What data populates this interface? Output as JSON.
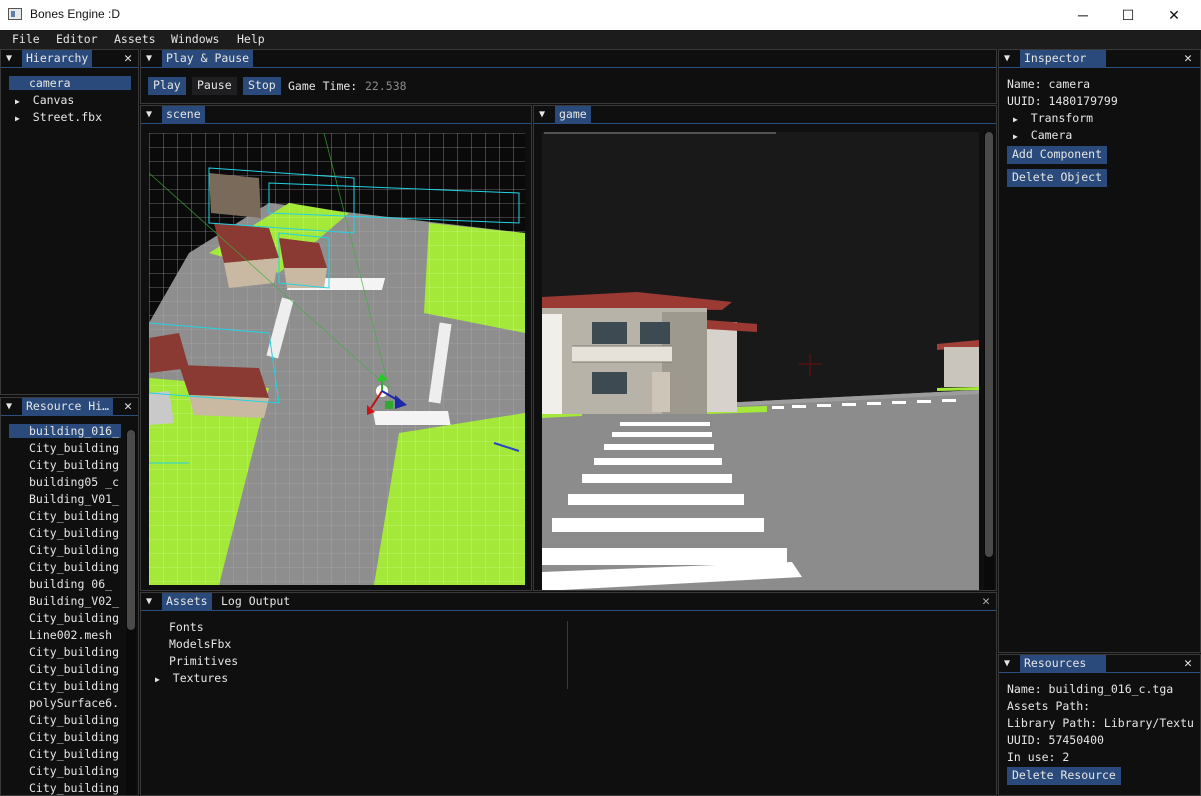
{
  "window": {
    "title": "Bones Engine :D",
    "minimize": "─",
    "maximize": "☐",
    "close": "✕"
  },
  "menu": [
    "File",
    "Editor",
    "Assets",
    "Windows",
    "Help"
  ],
  "hierarchy": {
    "title": "Hierarchy",
    "items": [
      {
        "label": "camera",
        "selected": true,
        "expandable": false
      },
      {
        "label": "Canvas",
        "selected": false,
        "expandable": true
      },
      {
        "label": "Street.fbx",
        "selected": false,
        "expandable": true
      }
    ]
  },
  "resource_hierarchy": {
    "title": "Resource Hi…",
    "items": [
      "building_016_",
      "City_building",
      "City_building",
      "building05 _c",
      "Building_V01_",
      "City_building",
      "City_building",
      "City_building",
      "City_building",
      "building 06_",
      "Building_V02_",
      "City_building",
      "Line002.mesh",
      "City_building",
      "City_building",
      "City_building",
      "polySurface6.",
      "City_building",
      "City_building",
      "City_building",
      "City_building",
      "City_building"
    ]
  },
  "play_pause": {
    "title": "Play & Pause",
    "play": "Play",
    "pause": "Pause",
    "stop": "Stop",
    "game_time_label": "Game Time:",
    "game_time_value": "22.538"
  },
  "scene": {
    "title": "scene"
  },
  "game": {
    "title": "game"
  },
  "assets": {
    "tabs": [
      "Assets",
      "Log Output"
    ],
    "folders": [
      {
        "label": "Fonts",
        "expandable": false
      },
      {
        "label": "ModelsFbx",
        "expandable": false
      },
      {
        "label": "Primitives",
        "expandable": false
      },
      {
        "label": "Textures",
        "expandable": true
      }
    ]
  },
  "inspector": {
    "title": "Inspector",
    "name": "Name: camera",
    "uuid": "UUID: 1480179799",
    "components": [
      "Transform",
      "Camera"
    ],
    "add_component": "Add Component",
    "delete_object": "Delete Object"
  },
  "resources": {
    "title": "Resources",
    "name": "Name: building_016_c.tga",
    "assets_path": "Assets Path:",
    "library_path": "Library Path: Library/Textu",
    "uuid": "UUID: 57450400",
    "in_use": "In use: 2",
    "delete_resource": "Delete Resource"
  },
  "icons": {
    "collapse": "▼",
    "expand": "▶",
    "close": "✕"
  },
  "colors": {
    "accent": "#294a7a",
    "panel_bg": "#0f0f10",
    "grass": "#a4e83a",
    "road": "#8c8c8c"
  }
}
